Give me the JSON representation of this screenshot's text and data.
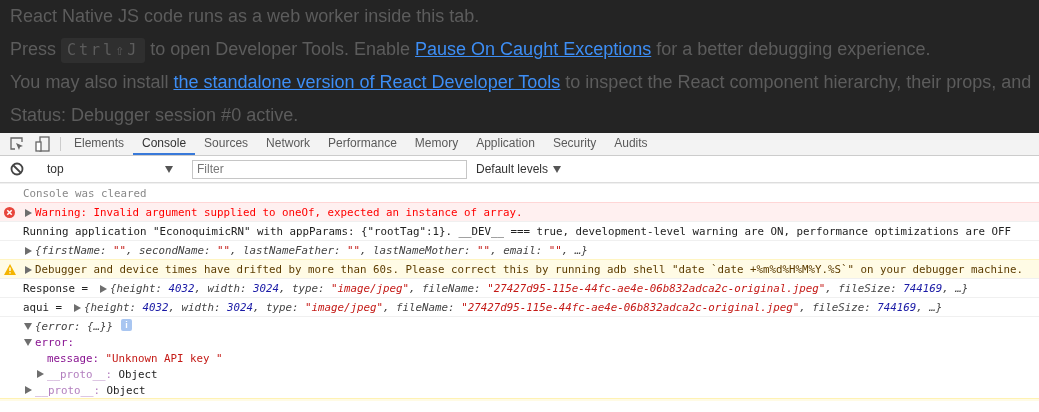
{
  "page": {
    "paragraphs": [
      {
        "segments": [
          {
            "kind": "text",
            "text": "React Native JS code runs as a web worker inside this tab."
          }
        ]
      },
      {
        "segments": [
          {
            "kind": "text",
            "text": "Press "
          },
          {
            "kind": "key",
            "text": "Ctrl⇧J"
          },
          {
            "kind": "text",
            "text": " to open Developer Tools. Enable "
          },
          {
            "kind": "link",
            "text": "Pause On Caught Exceptions"
          },
          {
            "kind": "text",
            "text": " for a better debugging experience."
          }
        ]
      },
      {
        "segments": [
          {
            "kind": "text",
            "text": "You may also install "
          },
          {
            "kind": "link",
            "text": "the standalone version of React Developer Tools"
          },
          {
            "kind": "text",
            "text": " to inspect the React component hierarchy, their props, and"
          }
        ]
      },
      {
        "segments": [
          {
            "kind": "text",
            "text": "Status: Debugger session #0 active."
          }
        ]
      }
    ]
  },
  "devtools": {
    "tabs": [
      {
        "label": "Elements",
        "selected": false
      },
      {
        "label": "Console",
        "selected": true
      },
      {
        "label": "Sources",
        "selected": false
      },
      {
        "label": "Network",
        "selected": false
      },
      {
        "label": "Performance",
        "selected": false
      },
      {
        "label": "Memory",
        "selected": false
      },
      {
        "label": "Application",
        "selected": false
      },
      {
        "label": "Security",
        "selected": false
      },
      {
        "label": "Audits",
        "selected": false
      }
    ],
    "context": "top",
    "filter": {
      "placeholder": "Filter"
    },
    "levels": "Default levels",
    "messages": [
      {
        "kind": "cleared",
        "segments": [
          {
            "kind": "plain",
            "text": "Console was cleared"
          }
        ]
      },
      {
        "kind": "error",
        "expanded": false,
        "segments": [
          {
            "kind": "plain",
            "text": "Warning: Invalid argument supplied to oneOf, expected an instance of array."
          }
        ]
      },
      {
        "kind": "log",
        "segments": [
          {
            "kind": "plain",
            "text": "Running application \"EconoquimicRN\" with appParams: {\"rootTag\":1}. __DEV__ === true, development-level warning are ON, performance optimizations are OFF"
          }
        ]
      },
      {
        "kind": "log",
        "expanded": false,
        "segments": [
          {
            "kind": "italic",
            "text": "{firstName: "
          },
          {
            "kind": "str",
            "text": "\"\""
          },
          {
            "kind": "italic",
            "text": ", secondName: "
          },
          {
            "kind": "str",
            "text": "\"\""
          },
          {
            "kind": "italic",
            "text": ", lastNameFather: "
          },
          {
            "kind": "str",
            "text": "\"\""
          },
          {
            "kind": "italic",
            "text": ", lastNameMother: "
          },
          {
            "kind": "str",
            "text": "\"\""
          },
          {
            "kind": "italic",
            "text": ", email: "
          },
          {
            "kind": "str",
            "text": "\"\""
          },
          {
            "kind": "italic",
            "text": ", …}"
          }
        ]
      },
      {
        "kind": "warning",
        "expanded": false,
        "segments": [
          {
            "kind": "plain",
            "text": "Debugger and device times have drifted by more than 60s. Please correct this by running adb shell \"date `date +%m%d%H%M%Y.%S`\" on your debugger machine."
          }
        ]
      },
      {
        "kind": "log",
        "label": "Response =",
        "expanded": false,
        "segments": [
          {
            "kind": "italic",
            "text": "{height: "
          },
          {
            "kind": "num",
            "text": "4032"
          },
          {
            "kind": "italic",
            "text": ", width: "
          },
          {
            "kind": "num",
            "text": "3024"
          },
          {
            "kind": "italic",
            "text": ", type: "
          },
          {
            "kind": "str",
            "text": "\"image/jpeg\""
          },
          {
            "kind": "italic",
            "text": ", fileName: "
          },
          {
            "kind": "str",
            "text": "\"27427d95-115e-44fc-ae4e-06b832adca2c-original.jpeg\""
          },
          {
            "kind": "italic",
            "text": ", fileSize: "
          },
          {
            "kind": "num",
            "text": "744169"
          },
          {
            "kind": "italic",
            "text": ", …}"
          }
        ]
      },
      {
        "kind": "log",
        "label": "aqui =",
        "expanded": false,
        "segments": [
          {
            "kind": "italic",
            "text": "{height: "
          },
          {
            "kind": "num",
            "text": "4032"
          },
          {
            "kind": "italic",
            "text": ", width: "
          },
          {
            "kind": "num",
            "text": "3024"
          },
          {
            "kind": "italic",
            "text": ", type: "
          },
          {
            "kind": "str",
            "text": "\"image/jpeg\""
          },
          {
            "kind": "italic",
            "text": ", fileName: "
          },
          {
            "kind": "str",
            "text": "\"27427d95-115e-44fc-ae4e-06b832adca2c-original.jpeg\""
          },
          {
            "kind": "italic",
            "text": ", fileSize: "
          },
          {
            "kind": "num",
            "text": "744169"
          },
          {
            "kind": "italic",
            "text": ", …}"
          }
        ]
      },
      {
        "kind": "log",
        "expanded": true,
        "badge": "i",
        "segments": [
          {
            "kind": "italic",
            "text": "{error: {…}}"
          }
        ],
        "children": [
          {
            "kind": "prop",
            "key": "error:",
            "expanded": true,
            "children": [
              {
                "kind": "prop",
                "key": "message:",
                "value": "\"Unknown API key \"",
                "string_value": true
              },
              {
                "kind": "proto",
                "key": "__proto__:",
                "value": "Object",
                "string_value": false,
                "expanded": false
              }
            ]
          },
          {
            "kind": "proto",
            "key": "__proto__:",
            "value": "Object",
            "string_value": false,
            "expanded": false
          }
        ]
      }
    ]
  }
}
